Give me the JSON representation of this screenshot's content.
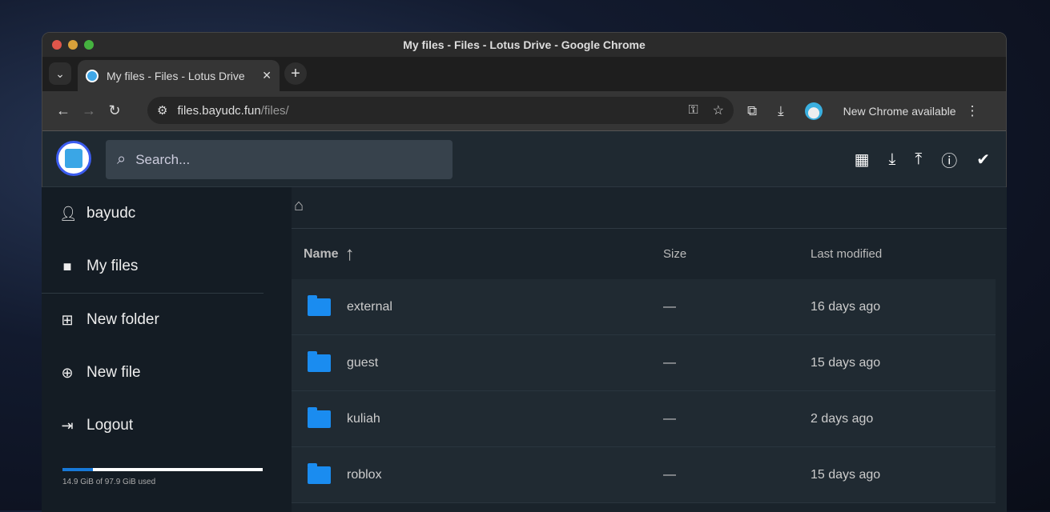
{
  "window": {
    "title": "My files - Files - Lotus Drive - Google Chrome"
  },
  "tab": {
    "title": "My files - Files - Lotus Drive",
    "close": "✕",
    "new": "+"
  },
  "omnibox": {
    "host": "files.bayudc.fun",
    "path": "/files/"
  },
  "chrome": {
    "new_chrome": "New Chrome available"
  },
  "search": {
    "placeholder": "Search..."
  },
  "sidebar": {
    "items": [
      {
        "label": "bayudc"
      },
      {
        "label": "My files"
      },
      {
        "label": "New folder"
      },
      {
        "label": "New file"
      },
      {
        "label": "Logout"
      }
    ]
  },
  "usage": {
    "text": "14.9 GiB of 97.9 GiB used",
    "fraction": 0.152
  },
  "table": {
    "headers": {
      "name": "Name",
      "size": "Size",
      "modified": "Last modified"
    },
    "rows": [
      {
        "name": "external",
        "size": "—",
        "modified": "16 days ago"
      },
      {
        "name": "guest",
        "size": "—",
        "modified": "15 days ago"
      },
      {
        "name": "kuliah",
        "size": "—",
        "modified": "2 days ago"
      },
      {
        "name": "roblox",
        "size": "—",
        "modified": "15 days ago"
      }
    ]
  },
  "colors": {
    "accent": "#1a8cf0",
    "logo_ring": "#3b5cf0"
  }
}
